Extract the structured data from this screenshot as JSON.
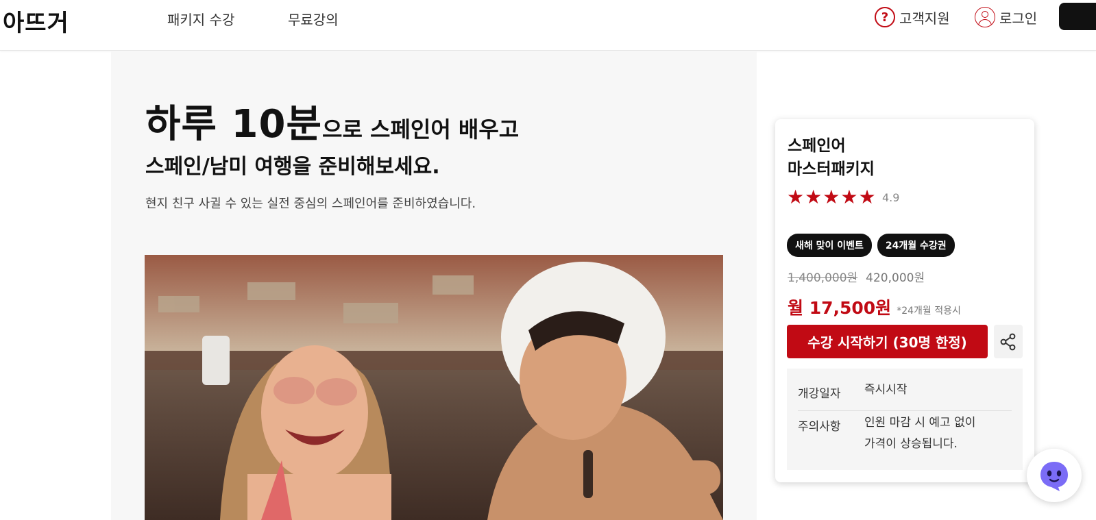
{
  "header": {
    "logo": "아뜨거",
    "nav": [
      "패키지 수강",
      "무료강의"
    ],
    "support_label": "고객지원",
    "login_label": "로그인"
  },
  "hero": {
    "headline_big": "하루 10분",
    "headline_rest": "으로 스페인어 배우고",
    "headline_line2": "스페인/남미 여행을 준비해보세요.",
    "subtext": "현지 친구 사귈 수 있는 실전 중심의 스페인어를 준비하였습니다."
  },
  "card": {
    "title_line1": "스페인어",
    "title_line2": "마스터패키지",
    "stars": 5,
    "rating": "4.9",
    "badges": [
      "새해 맞이 이벤트",
      "24개월 수강권"
    ],
    "original_price": "1,400,000원",
    "sale_price": "420,000원",
    "monthly_price": "월 17,500원",
    "monthly_note": "*24개월 적용시",
    "cta_label": "수강 시작하기 (30명 한정)",
    "info": [
      {
        "key": "개강일자",
        "value": "즉시시작"
      },
      {
        "key": "주의사항",
        "value_line1": "인원 마감 시 예고 없이",
        "value_line2": "가격이 상승됩니다."
      }
    ]
  },
  "colors": {
    "accent": "#c10a14",
    "dark": "#111111",
    "panel_bg": "#f7f7f7"
  }
}
